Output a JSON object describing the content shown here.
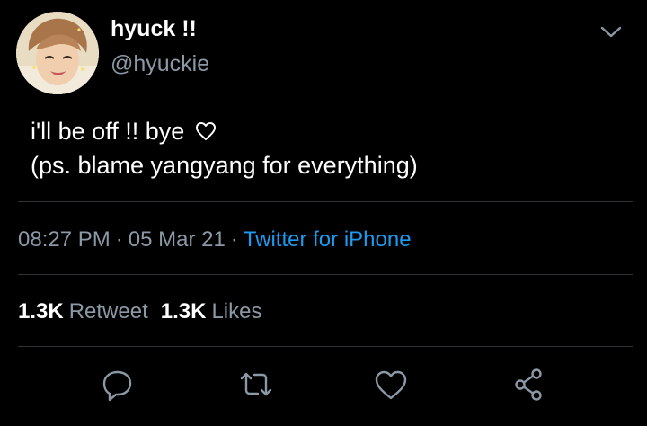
{
  "tweet": {
    "author": {
      "display_name": "hyuck !!",
      "handle": "@hyuckie",
      "avatar_icon": "profile-photo"
    },
    "text_lines": [
      "i'll be off !! bye",
      "(ps. blame yangyang for everything)"
    ],
    "text_trailing_icon": "heart-outline-icon",
    "time": "08:27 PM",
    "date": "05 Mar 21",
    "separator": "·",
    "source": "Twitter for iPhone",
    "stats": {
      "retweets_count": "1.3K",
      "retweets_label": "Retweet",
      "likes_count": "1.3K",
      "likes_label": "Likes"
    },
    "actions": [
      "reply-icon",
      "retweet-icon",
      "like-icon",
      "share-icon"
    ]
  },
  "colors": {
    "background": "#000000",
    "text_primary": "#ffffff",
    "text_secondary": "#8b98a5",
    "link": "#1d9bf0",
    "divider": "#2f3336"
  }
}
